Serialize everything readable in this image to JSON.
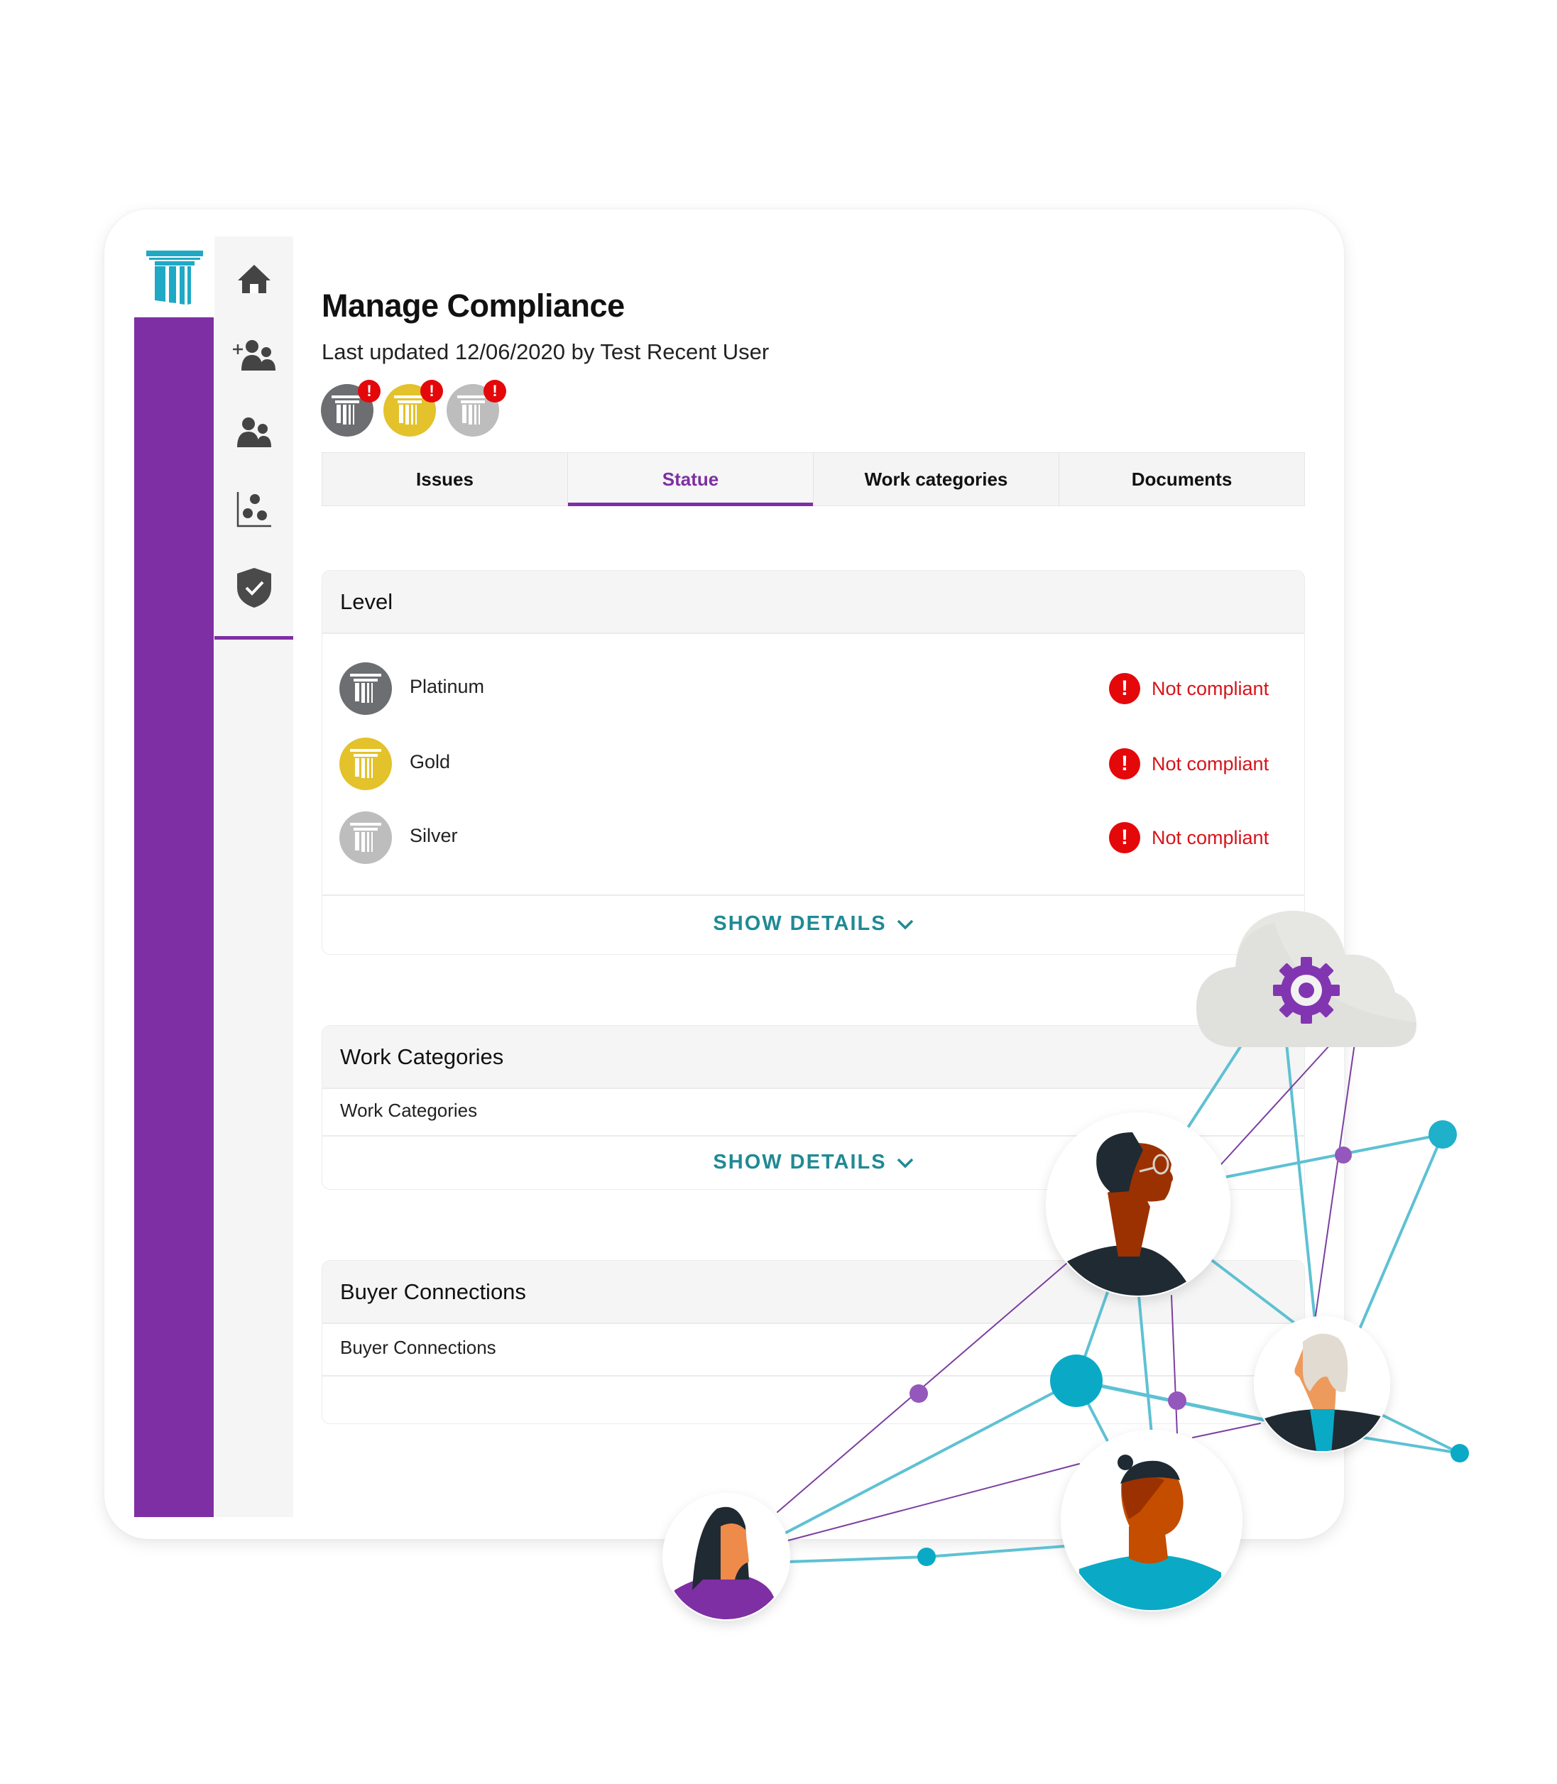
{
  "header": {
    "title": "Manage Compliance",
    "last_updated": "Last updated 12/06/2020 by Test Recent User"
  },
  "sidebar": {
    "logo": "pillar-logo",
    "items": [
      {
        "name": "home",
        "icon": "home-icon"
      },
      {
        "name": "add-user",
        "icon": "add-user-icon"
      },
      {
        "name": "users",
        "icon": "users-icon"
      },
      {
        "name": "analytics",
        "icon": "scatter-chart-icon"
      },
      {
        "name": "compliance",
        "icon": "shield-check-icon",
        "active": true
      }
    ]
  },
  "badges": [
    {
      "level": "Platinum",
      "color": "#6c6e71",
      "alert": "!"
    },
    {
      "level": "Gold",
      "color": "#e3c22b",
      "alert": "!"
    },
    {
      "level": "Silver",
      "color": "#bdbdbd",
      "alert": "!"
    }
  ],
  "tabs": [
    {
      "label": "Issues",
      "active": false
    },
    {
      "label": "Statue",
      "active": true
    },
    {
      "label": "Work categories",
      "active": false
    },
    {
      "label": "Documents",
      "active": false
    }
  ],
  "level_section": {
    "title": "Level",
    "rows": [
      {
        "label": "Platinum",
        "color": "#6c6e71",
        "status": "Not compliant",
        "alert": "!"
      },
      {
        "label": "Gold",
        "color": "#e3c22b",
        "status": "Not compliant",
        "alert": "!"
      },
      {
        "label": "Silver",
        "color": "#bdbdbd",
        "status": "Not compliant",
        "alert": "!"
      }
    ],
    "show_details": "SHOW DETAILS"
  },
  "work_categories_section": {
    "title": "Work Categories",
    "body": "Work Categories",
    "show_details": "SHOW DETAILS"
  },
  "buyer_connections_section": {
    "title": "Buyer Connections",
    "body": "Buyer Connections"
  },
  "colors": {
    "brand_purple": "#7e2fa3",
    "brand_teal": "#1fa9c4",
    "link_teal": "#1f8a94",
    "alert_red": "#e4080a",
    "status_red": "#d7141a"
  }
}
